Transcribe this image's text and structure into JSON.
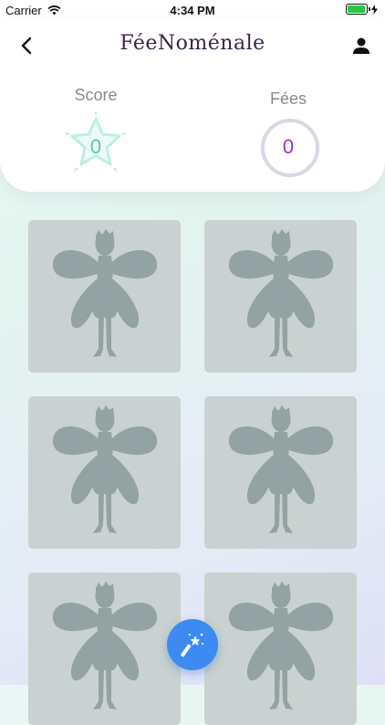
{
  "status": {
    "carrier": "Carrier",
    "time": "4:34 PM"
  },
  "header": {
    "logo": "FéeNoménale"
  },
  "stats": {
    "score_label": "Score",
    "score_value": "0",
    "fees_label": "Fées",
    "fees_value": "0"
  },
  "cards": [
    {
      "state": "locked"
    },
    {
      "state": "locked"
    },
    {
      "state": "locked"
    },
    {
      "state": "locked"
    },
    {
      "state": "locked"
    },
    {
      "state": "locked"
    }
  ],
  "icons": {
    "back": "chevron-left-icon",
    "user": "user-icon",
    "score": "star-icon",
    "fab": "magic-wand-icon"
  },
  "colors": {
    "score_accent": "#4fcbb6",
    "fees_accent": "#a331c9",
    "fab": "#3d8bf0",
    "card": "#c9d2d0",
    "logo": "#3a234e"
  }
}
